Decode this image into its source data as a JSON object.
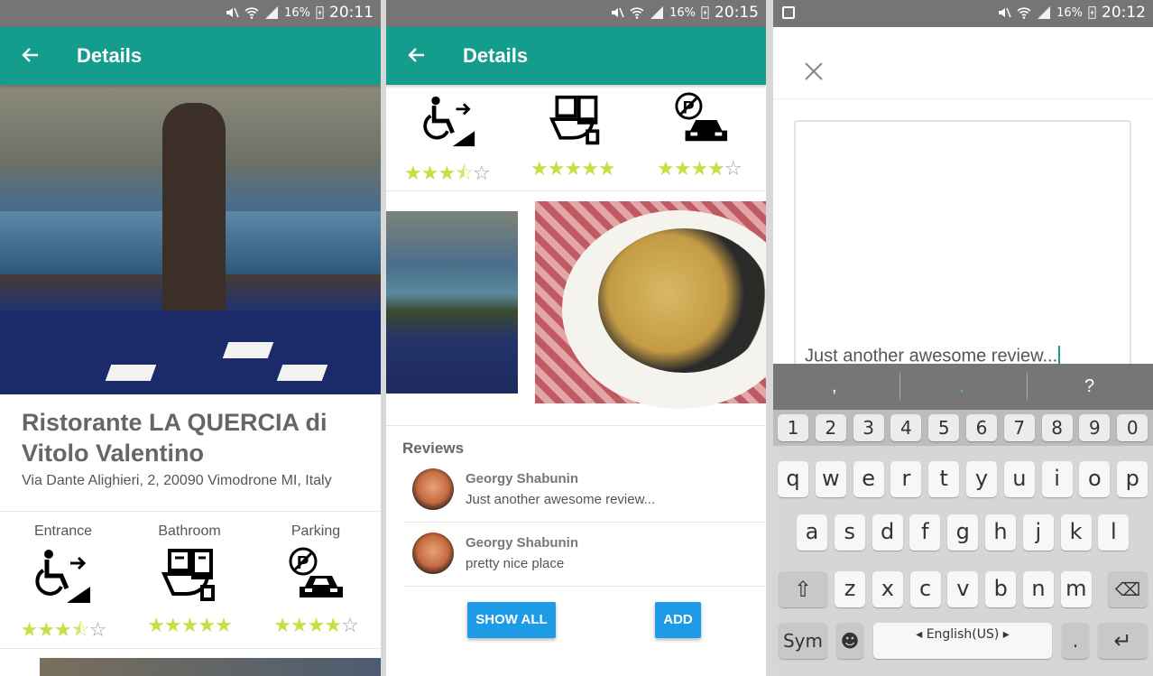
{
  "status": [
    {
      "battery": "16%",
      "time": "20:11"
    },
    {
      "battery": "16%",
      "time": "20:15"
    },
    {
      "battery": "16%",
      "time": "20:12"
    }
  ],
  "colors": {
    "appbar": "#149c8c",
    "star_on": "#c6df44",
    "star_off": "#9aa0a0",
    "button": "#1e9be6"
  },
  "details": {
    "title": "Details",
    "back_icon": "arrow-left-icon",
    "restaurant_name": "Ristorante LA QUERCIA di Vitolo Valentino",
    "address": "Via Dante Alighieri, 2, 20090 Vimodrone MI, Italy",
    "features": [
      {
        "label": "Entrance",
        "icon": "wheelchair-ramp-icon",
        "rating": 3.5
      },
      {
        "label": "Bathroom",
        "icon": "accessible-toilet-icon",
        "rating": 5
      },
      {
        "label": "Parking",
        "icon": "no-parking-car-icon",
        "rating": 4
      }
    ]
  },
  "reviews": {
    "title": "Reviews",
    "items": [
      {
        "author": "Georgy  Shabunin",
        "text": "Just another awesome review..."
      },
      {
        "author": "Georgy  Shabunin",
        "text": "pretty nice place"
      }
    ],
    "show_all_label": "SHOW ALL",
    "add_label": "ADD"
  },
  "compose": {
    "close_icon": "close-icon",
    "text": "Just another awesome review..."
  },
  "keyboard": {
    "suggestions": [
      ",",
      ".",
      "?"
    ],
    "numbers": [
      "1",
      "2",
      "3",
      "4",
      "5",
      "6",
      "7",
      "8",
      "9",
      "0"
    ],
    "row1": [
      "q",
      "w",
      "e",
      "r",
      "t",
      "y",
      "u",
      "i",
      "o",
      "p"
    ],
    "row2": [
      "a",
      "s",
      "d",
      "f",
      "g",
      "h",
      "j",
      "k",
      "l"
    ],
    "row3": [
      "z",
      "x",
      "c",
      "v",
      "b",
      "n",
      "m"
    ],
    "sym_label": "Sym",
    "language_label": "English(US)"
  }
}
